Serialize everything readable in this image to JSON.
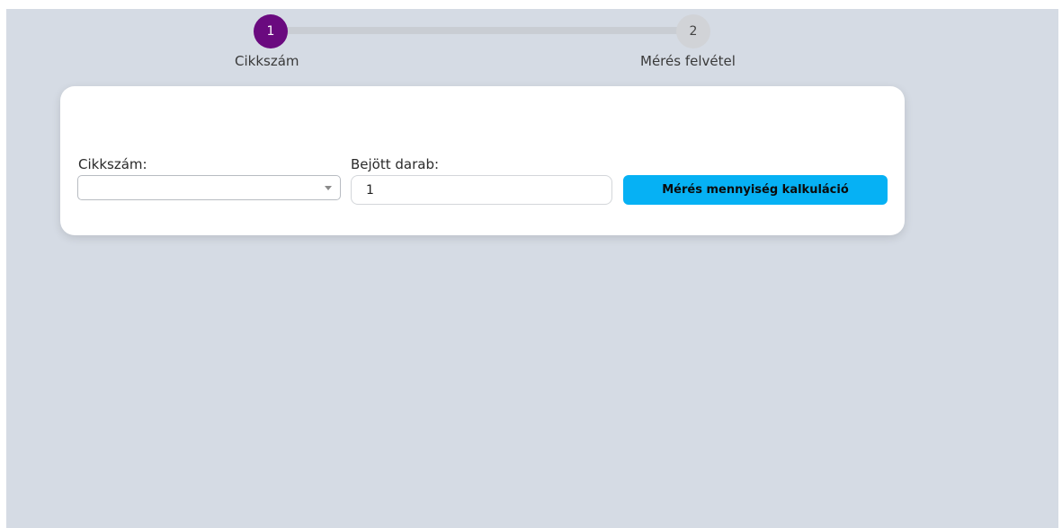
{
  "stepper": {
    "steps": [
      {
        "number": "1",
        "label": "Cikkszám",
        "state": "active"
      },
      {
        "number": "2",
        "label": "Mérés felvétel",
        "state": "inactive"
      }
    ],
    "colors": {
      "active": "#6a0a7f",
      "inactive": "#d1d3d7",
      "track": "#c9cdd3"
    }
  },
  "form": {
    "cikkszam_label": "Cikkszám:",
    "cikkszam_value": "",
    "darab_label": "Bejött darab:",
    "darab_value": "1",
    "calc_button_label": "Mérés mennyiség kalkuláció"
  },
  "colors": {
    "background": "#d5dbe4",
    "card": "#ffffff",
    "button": "#06b1f4"
  },
  "icons": {
    "dropdown": "chevron-down-icon"
  }
}
